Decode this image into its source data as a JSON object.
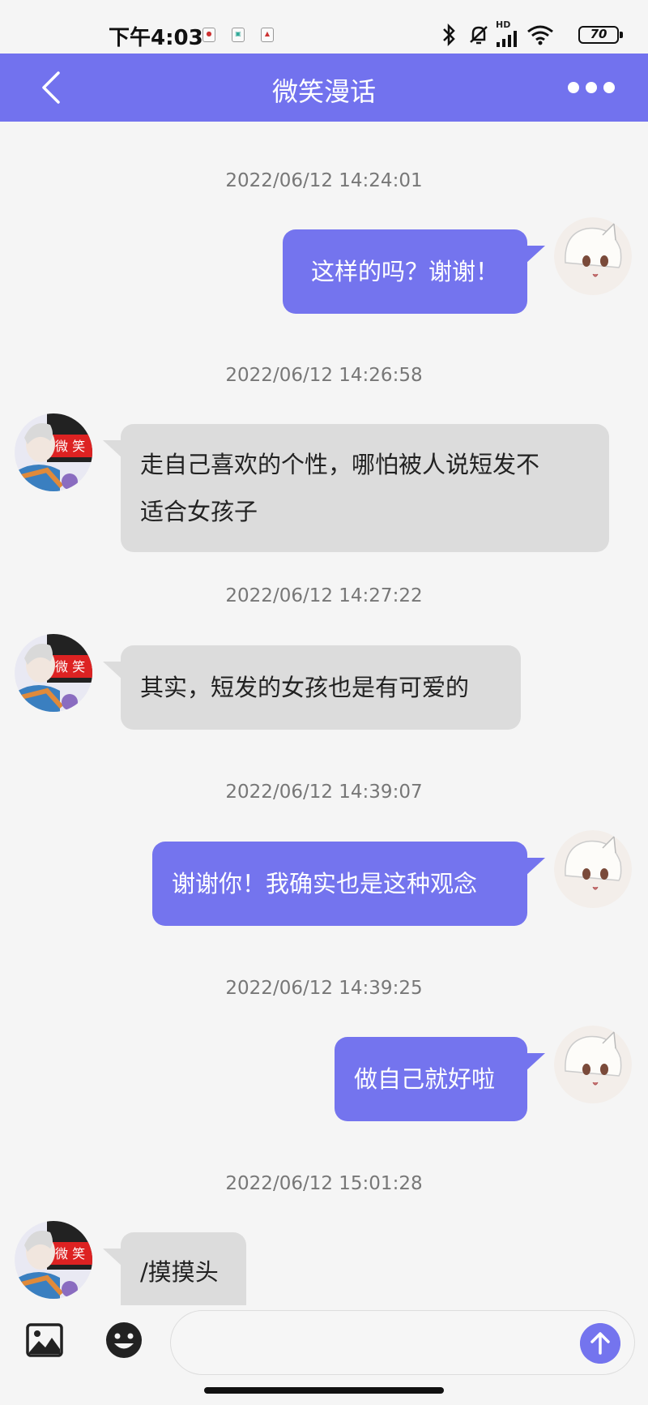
{
  "status_bar": {
    "time": "下午4:03",
    "battery": "70",
    "network_badge": "HD",
    "icons": [
      "bluetooth-icon",
      "mute-bell-icon",
      "signal-icon",
      "wifi-icon",
      "battery-icon"
    ]
  },
  "header": {
    "title": "微笑漫话",
    "back_icon": "chevron-left-icon",
    "more_icon": "more-dots-icon",
    "color": "#7272ee"
  },
  "messages": [
    {
      "timestamp": "2022/06/12 14:24:01",
      "direction": "out",
      "text": "这样的吗？谢谢！"
    },
    {
      "timestamp": "2022/06/12 14:26:58",
      "direction": "in",
      "text_line1": "走自己喜欢的个性，哪怕被人说短发不",
      "text_line2": "适合女孩子"
    },
    {
      "timestamp": "2022/06/12 14:27:22",
      "direction": "in",
      "text": "其实，短发的女孩也是有可爱的"
    },
    {
      "timestamp": "2022/06/12 14:39:07",
      "direction": "out",
      "text": "谢谢你！我确实也是这种观念"
    },
    {
      "timestamp": "2022/06/12 14:39:25",
      "direction": "out",
      "text": "做自己就好啦"
    },
    {
      "timestamp": "2022/06/12 15:01:28",
      "direction": "in",
      "text": "/摸摸头"
    }
  ],
  "input_bar": {
    "placeholder": "",
    "image_icon": "image-icon",
    "emoji_icon": "emoji-icon",
    "send_icon": "send-arrow-icon"
  },
  "colors": {
    "outgoing_bubble": "#7474ee",
    "incoming_bubble": "#dcdcdc",
    "background": "#f5f5f5"
  }
}
